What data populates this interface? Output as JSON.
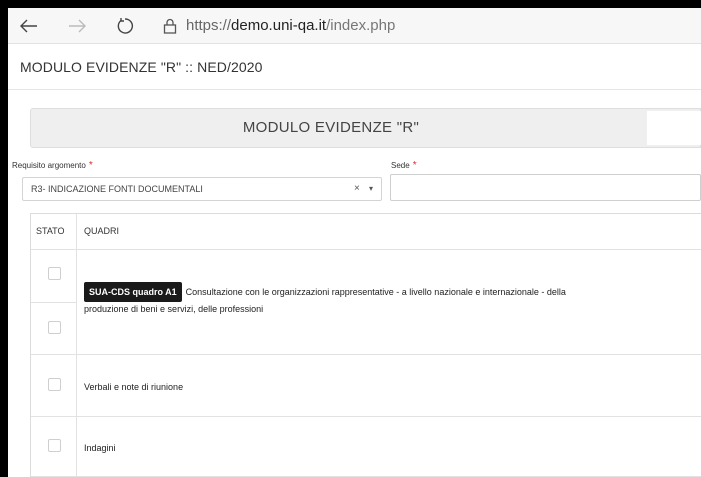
{
  "browser": {
    "url_scheme": "https://",
    "url_host": "demo.uni-qa.it",
    "url_path": "/index.php"
  },
  "header": {
    "title": "MODULO EVIDENZE \"R\" :: NED/2020"
  },
  "banner": {
    "title": "MODULO EVIDENZE \"R\""
  },
  "form": {
    "requisito_label": "Requisito argomento",
    "requisito_value": "R3- INDICAZIONE FONTI DOCUMENTALI",
    "clear_symbol": "×",
    "caret_symbol": "▾",
    "sede_label": "Sede",
    "required_marker": "*",
    "sede_value": ""
  },
  "table": {
    "headers": {
      "stato": "STATO",
      "quadri": "QUADRI"
    },
    "rows": [
      {
        "tag": "SUA-CDS quadro A1",
        "text": "Consultazione con le organizzazioni rappresentative - a livello nazionale e internazionale - della",
        "text2": "produzione di beni e servizi, delle professioni"
      },
      {
        "text": "Verbali e note di riunione"
      },
      {
        "text": "Indagini"
      }
    ]
  },
  "colors": {
    "required": "#e02b2b",
    "tag_bg": "#1a1a1a",
    "banner_bg": "#efefef"
  }
}
